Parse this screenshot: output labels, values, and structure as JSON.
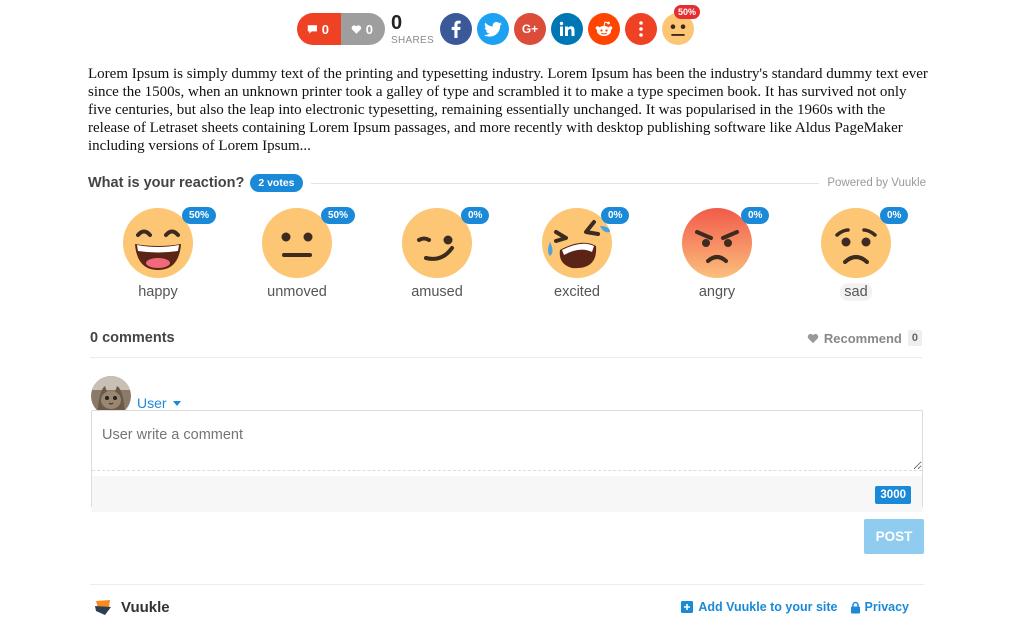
{
  "share_bar": {
    "comment_count": "0",
    "like_count": "0",
    "shares_count": "0",
    "shares_label": "SHARES",
    "google_plus_label": "G+",
    "reaction_badge": "50%",
    "icons": [
      "comment-icon",
      "heart-icon",
      "facebook-icon",
      "twitter-icon",
      "google-plus-icon",
      "linkedin-icon",
      "reddit-icon",
      "more-icon",
      "unmoved-emoji-icon"
    ],
    "colors": {
      "comments": "#ef4123",
      "likes": "#9e9e9e",
      "facebook": "#3b5998",
      "twitter": "#1da1f2",
      "google_plus": "#dd4b39",
      "linkedin": "#0077b5",
      "reddit": "#ff4500",
      "more": "#ef4123"
    }
  },
  "article": {
    "text": "Lorem Ipsum is simply dummy text of the printing and typesetting industry. Lorem Ipsum has been the industry's standard dummy text ever since the 1500s, when an unknown printer took a galley of type and scrambled it to make a type specimen book. It has survived not only five centuries, but also the leap into electronic typesetting, remaining essentially unchanged. It was popularised in the 1960s with the release of Letraset sheets containing Lorem Ipsum passages, and more recently with desktop publishing software like Aldus PageMaker including versions of Lorem Ipsum..."
  },
  "reactions": {
    "title": "What is your reaction?",
    "votes": "2 votes",
    "powered_by": "Powered by Vuukle",
    "items": [
      {
        "label": "happy",
        "percent": "50%"
      },
      {
        "label": "unmoved",
        "percent": "50%"
      },
      {
        "label": "amused",
        "percent": "0%"
      },
      {
        "label": "excited",
        "percent": "0%"
      },
      {
        "label": "angry",
        "percent": "0%"
      },
      {
        "label": "sad",
        "percent": "0%"
      }
    ]
  },
  "comments": {
    "count_label": "0 comments",
    "recommend_label": "Recommend",
    "recommend_count": "0",
    "user_name": "User",
    "placeholder": "User write a comment",
    "char_limit": "3000",
    "post_label": "POST"
  },
  "footer": {
    "brand": "Vuukle",
    "add_link": "Add Vuukle to your site",
    "privacy_link": "Privacy"
  },
  "accent_color": "#1a8ad8"
}
